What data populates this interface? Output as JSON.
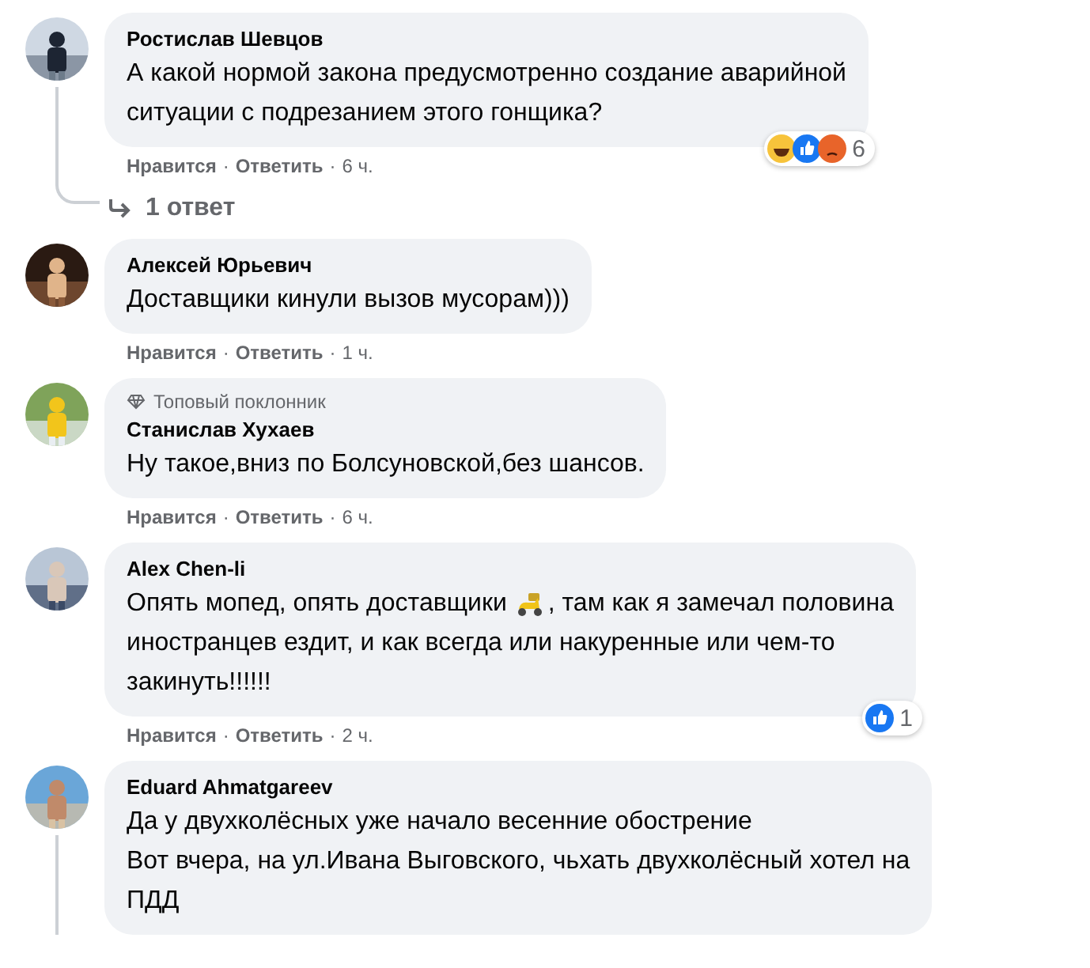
{
  "comments": [
    {
      "author": "Ростислав Шевцов",
      "lines": [
        [
          {
            "kind": "text",
            "text": "А какой нормой закона предусмотренно создание аварийной"
          }
        ],
        [
          {
            "kind": "text",
            "text": "ситуации с подрезанием этого гонщика?"
          }
        ]
      ],
      "actions": {
        "like": "Нравится",
        "separator": "·",
        "reply": "Ответить",
        "time": "6 ч."
      },
      "reactions": {
        "types": [
          {
            "kind": "haha"
          },
          {
            "kind": "like"
          },
          {
            "kind": "angry"
          }
        ],
        "count": "6"
      },
      "replies": "1 ответ",
      "thread": true
    },
    {
      "author": "Алексей Юрьевич",
      "lines": [
        [
          {
            "kind": "text",
            "text": "Доставщики кинули вызов мусорам)))"
          }
        ]
      ],
      "actions": {
        "like": "Нравится",
        "separator": "·",
        "reply": "Ответить",
        "time": "1 ч."
      }
    },
    {
      "badge": "Топовый поклонник",
      "author": "Станислав Хухаев",
      "lines": [
        [
          {
            "kind": "text",
            "text": "Ну такое,вниз по Болсуновской,без шансов."
          }
        ]
      ],
      "actions": {
        "like": "Нравится",
        "separator": "·",
        "reply": "Ответить",
        "time": "6 ч."
      }
    },
    {
      "author": "Alex Chen-li",
      "lines": [
        [
          {
            "kind": "text",
            "text": "Опять мопед, опять доставщики"
          },
          {
            "kind": "scooter"
          },
          {
            "kind": "text",
            "text": ", там как я замечал половина"
          }
        ],
        [
          {
            "kind": "text",
            "text": "иностранцев ездит, и как всегда или накуренные или чем-то"
          }
        ],
        [
          {
            "kind": "text",
            "text": "закинуть!!!!!!"
          }
        ]
      ],
      "actions": {
        "like": "Нравится",
        "separator": "·",
        "reply": "Ответить",
        "time": "2 ч."
      },
      "reactions": {
        "types": [
          {
            "kind": "like"
          }
        ],
        "count": "1"
      }
    },
    {
      "author": "Eduard Ahmatgareev",
      "lines": [
        [
          {
            "kind": "text",
            "text": "Да у двухколёсных уже начало весенние обострение"
          }
        ],
        [
          {
            "kind": "text",
            "text": "Вот вчера, на ул.Ивана Выговского, чьхать двухколёсный хотел на"
          }
        ],
        [
          {
            "kind": "text",
            "text": "ПДД"
          }
        ]
      ],
      "thread": true
    }
  ]
}
